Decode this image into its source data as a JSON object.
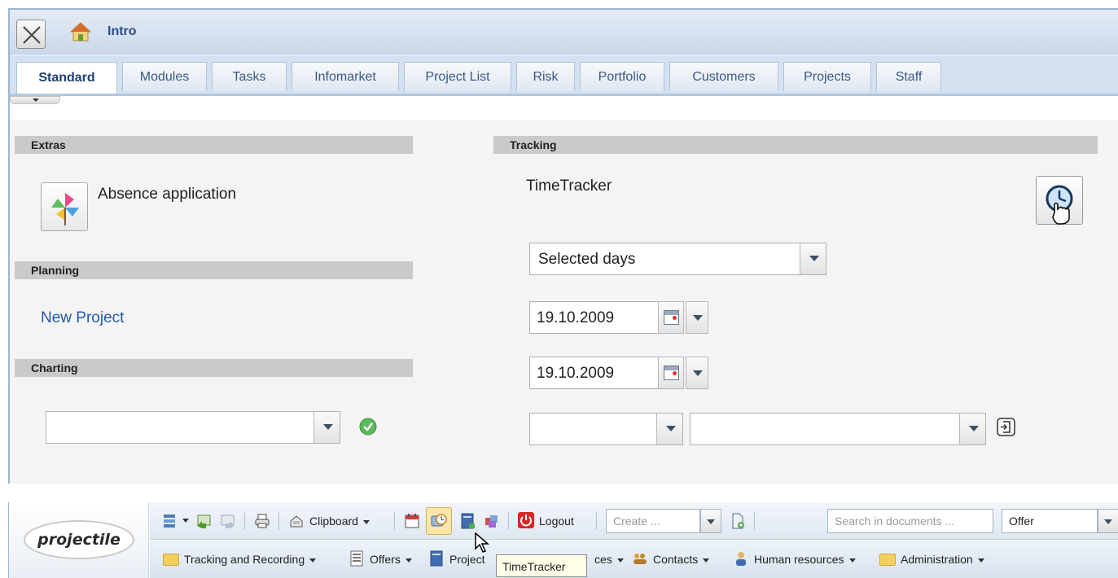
{
  "window": {
    "title": "Intro",
    "tabs": [
      "Standard",
      "Modules",
      "Tasks",
      "Infomarket",
      "Project List",
      "Risk",
      "Portfolio",
      "Customers",
      "Projects",
      "Staff"
    ]
  },
  "sections": {
    "extras": {
      "title": "Extras",
      "absence_label": "Absence application"
    },
    "planning": {
      "title": "Planning",
      "new_project": "New Project"
    },
    "charting": {
      "title": "Charting",
      "select_value": ""
    },
    "tracking": {
      "title": "Tracking",
      "timetracker_label": "TimeTracker",
      "period_select": "Selected days",
      "date_from": "19.10.2009",
      "date_to": "19.10.2009",
      "select_a": "",
      "select_b": ""
    }
  },
  "toolbar": {
    "logo": "projectile",
    "clipboard": "Clipboard",
    "logout": "Logout",
    "create_placeholder": "Create ...",
    "search_placeholder": "Search in documents ...",
    "search_scope": "Offer",
    "menu": {
      "tracking": "Tracking and Recording",
      "offers": "Offers",
      "projects": "Project",
      "resources": "ces",
      "contacts": "Contacts",
      "hr": "Human resources",
      "admin": "Administration"
    },
    "tooltip": "TimeTracker"
  }
}
